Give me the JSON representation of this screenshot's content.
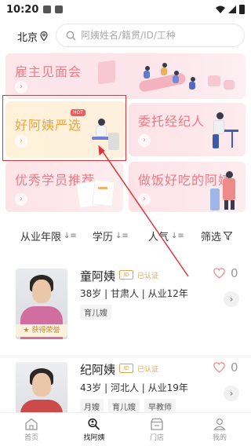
{
  "status_bar": {
    "time": "10:20"
  },
  "search": {
    "city": "北京",
    "placeholder": "阿姨姓名/籍贯/ID/工种"
  },
  "banners": [
    {
      "title": "雇主见面会"
    },
    {
      "title": "好阿姨严选",
      "badge": "HOT"
    },
    {
      "title": "委托经纪人"
    },
    {
      "title": "优秀学员推荐"
    },
    {
      "title": "做饭好吃的阿姨"
    }
  ],
  "filters": [
    {
      "label": "从业年限"
    },
    {
      "label": "学历"
    },
    {
      "label": "人气"
    },
    {
      "label": "筛选"
    }
  ],
  "cards": [
    {
      "name": "童阿姨",
      "cert": "已认证",
      "info": "38岁 | 甘肃人 | 从业12年",
      "tags": [
        "育儿嫂"
      ],
      "likes": "0",
      "honor": "获得荣誉"
    },
    {
      "name": "纪阿姨",
      "cert": "已认证",
      "info": "43岁 | 河北人 | 从业19年",
      "tags": [
        "月嫂",
        "育儿嫂",
        "早教师"
      ],
      "likes": "0"
    }
  ],
  "nav": [
    {
      "label": "首页",
      "icon": "home-icon"
    },
    {
      "label": "找阿姨",
      "icon": "search-person-icon",
      "active": true
    },
    {
      "label": "门店",
      "icon": "store-icon"
    },
    {
      "label": "我的",
      "icon": "user-icon"
    }
  ],
  "colors": {
    "banner_pink": "#ee7a86",
    "banner_gold": "#f0a43a",
    "annotation_red": "#e0333a",
    "heart": "#ee8590"
  }
}
